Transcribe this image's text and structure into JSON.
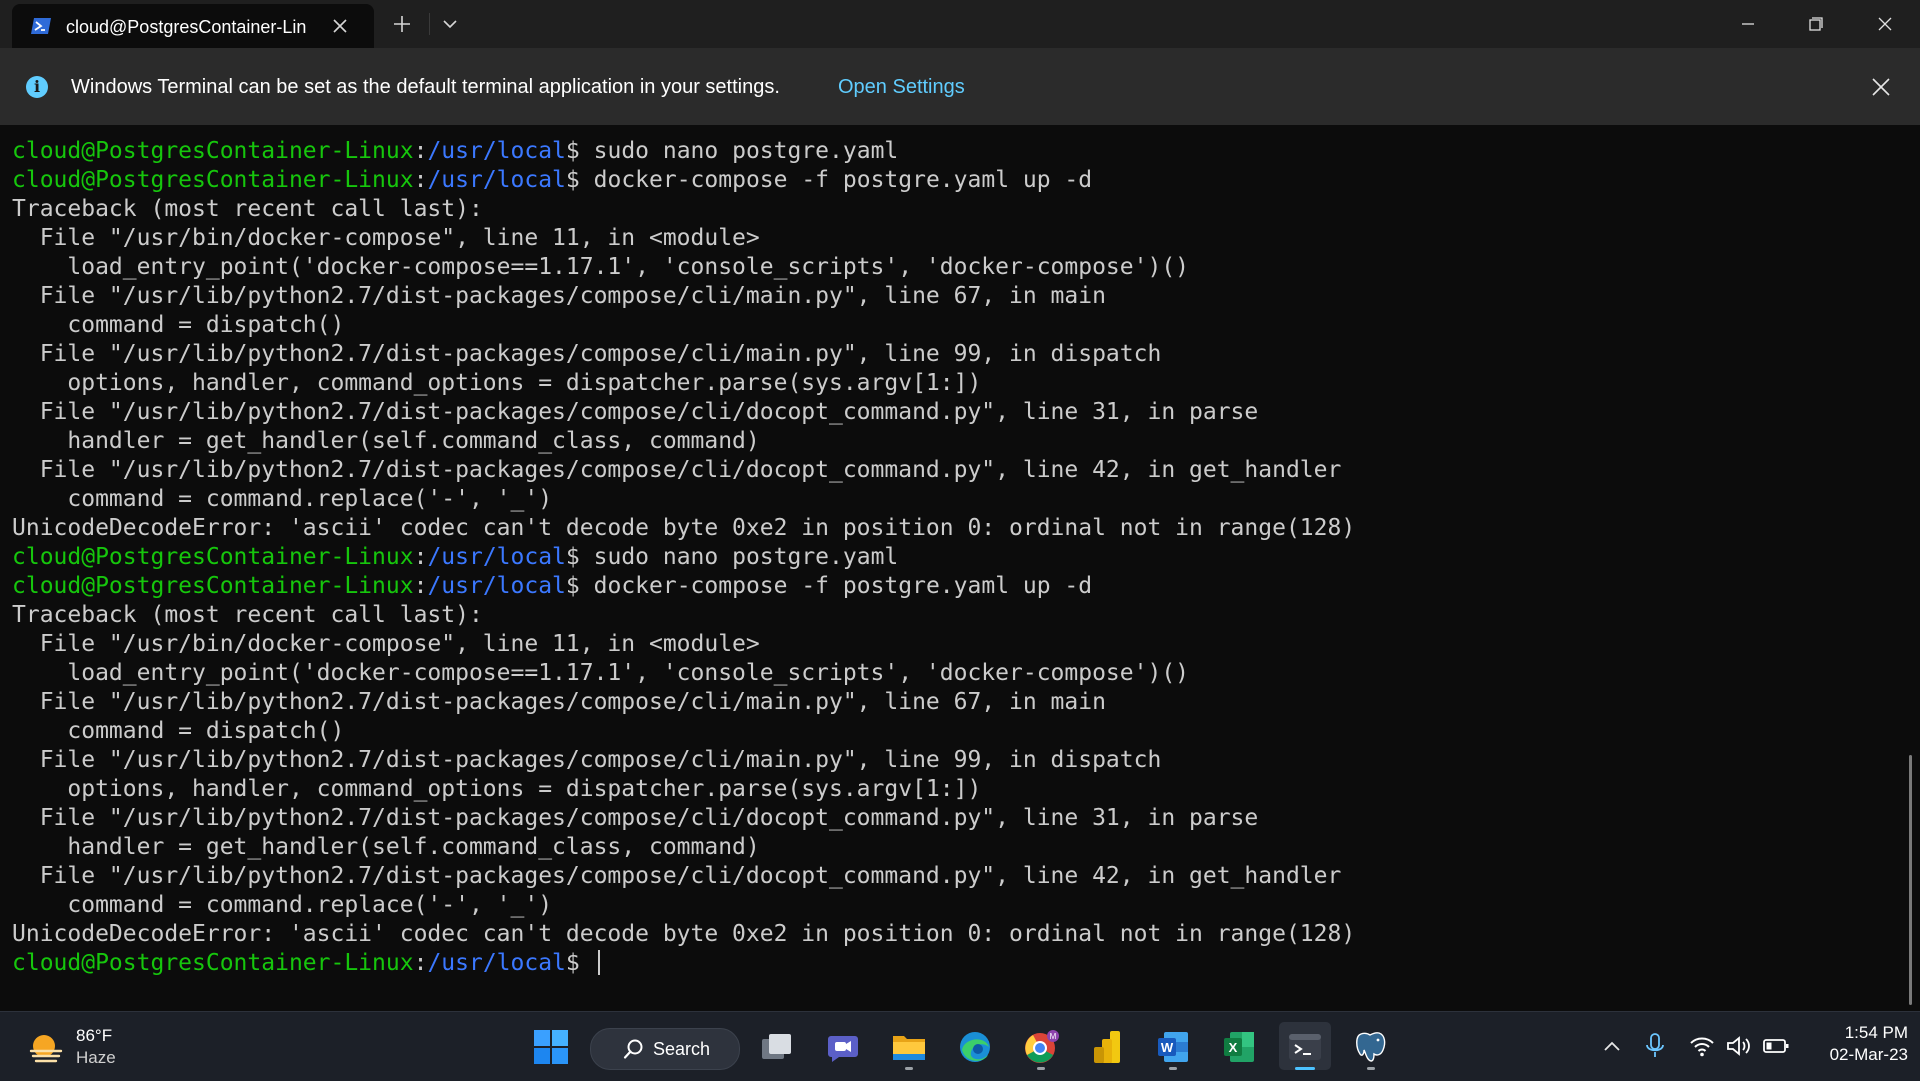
{
  "window": {
    "tab_title": "cloud@PostgresContainer-Lin",
    "accent_color": "#60cdff"
  },
  "infobar": {
    "message": "Windows Terminal can be set as the default terminal application in your settings.",
    "link": "Open Settings"
  },
  "terminal": {
    "colors": {
      "user_host": "#16c60c",
      "path": "#3b78ff",
      "text": "#cccccc",
      "background": "#0c0c0c"
    },
    "lines": [
      {
        "type": "prompt",
        "user": "cloud@PostgresContainer-Linux",
        "sep": ":",
        "path": "/usr/local",
        "sym": "$ ",
        "cmd": "sudo nano postgre.yaml"
      },
      {
        "type": "prompt",
        "user": "cloud@PostgresContainer-Linux",
        "sep": ":",
        "path": "/usr/local",
        "sym": "$ ",
        "cmd": "docker-compose -f postgre.yaml up -d"
      },
      {
        "type": "output",
        "text": "Traceback (most recent call last):"
      },
      {
        "type": "output",
        "text": "  File \"/usr/bin/docker-compose\", line 11, in <module>"
      },
      {
        "type": "output",
        "text": "    load_entry_point('docker-compose==1.17.1', 'console_scripts', 'docker-compose')()"
      },
      {
        "type": "output",
        "text": "  File \"/usr/lib/python2.7/dist-packages/compose/cli/main.py\", line 67, in main"
      },
      {
        "type": "output",
        "text": "    command = dispatch()"
      },
      {
        "type": "output",
        "text": "  File \"/usr/lib/python2.7/dist-packages/compose/cli/main.py\", line 99, in dispatch"
      },
      {
        "type": "output",
        "text": "    options, handler, command_options = dispatcher.parse(sys.argv[1:])"
      },
      {
        "type": "output",
        "text": "  File \"/usr/lib/python2.7/dist-packages/compose/cli/docopt_command.py\", line 31, in parse"
      },
      {
        "type": "output",
        "text": "    handler = get_handler(self.command_class, command)"
      },
      {
        "type": "output",
        "text": "  File \"/usr/lib/python2.7/dist-packages/compose/cli/docopt_command.py\", line 42, in get_handler"
      },
      {
        "type": "output",
        "text": "    command = command.replace('-', '_')"
      },
      {
        "type": "output",
        "text": "UnicodeDecodeError: 'ascii' codec can't decode byte 0xe2 in position 0: ordinal not in range(128)"
      },
      {
        "type": "prompt",
        "user": "cloud@PostgresContainer-Linux",
        "sep": ":",
        "path": "/usr/local",
        "sym": "$ ",
        "cmd": "sudo nano postgre.yaml"
      },
      {
        "type": "prompt",
        "user": "cloud@PostgresContainer-Linux",
        "sep": ":",
        "path": "/usr/local",
        "sym": "$ ",
        "cmd": "docker-compose -f postgre.yaml up -d"
      },
      {
        "type": "output",
        "text": "Traceback (most recent call last):"
      },
      {
        "type": "output",
        "text": "  File \"/usr/bin/docker-compose\", line 11, in <module>"
      },
      {
        "type": "output",
        "text": "    load_entry_point('docker-compose==1.17.1', 'console_scripts', 'docker-compose')()"
      },
      {
        "type": "output",
        "text": "  File \"/usr/lib/python2.7/dist-packages/compose/cli/main.py\", line 67, in main"
      },
      {
        "type": "output",
        "text": "    command = dispatch()"
      },
      {
        "type": "output",
        "text": "  File \"/usr/lib/python2.7/dist-packages/compose/cli/main.py\", line 99, in dispatch"
      },
      {
        "type": "output",
        "text": "    options, handler, command_options = dispatcher.parse(sys.argv[1:])"
      },
      {
        "type": "output",
        "text": "  File \"/usr/lib/python2.7/dist-packages/compose/cli/docopt_command.py\", line 31, in parse"
      },
      {
        "type": "output",
        "text": "    handler = get_handler(self.command_class, command)"
      },
      {
        "type": "output",
        "text": "  File \"/usr/lib/python2.7/dist-packages/compose/cli/docopt_command.py\", line 42, in get_handler"
      },
      {
        "type": "output",
        "text": "    command = command.replace('-', '_')"
      },
      {
        "type": "output",
        "text": "UnicodeDecodeError: 'ascii' codec can't decode byte 0xe2 in position 0: ordinal not in range(128)"
      },
      {
        "type": "prompt",
        "user": "cloud@PostgresContainer-Linux",
        "sep": ":",
        "path": "/usr/local",
        "sym": "$ ",
        "cmd": "",
        "cursor": true
      }
    ]
  },
  "taskbar": {
    "weather": {
      "temp": "86°F",
      "condition": "Haze",
      "icon": "sun-haze-icon"
    },
    "search_label": "Search",
    "apps": [
      {
        "name": "start-button",
        "icon": "windows-logo-icon"
      },
      {
        "name": "task-view-button",
        "icon": "task-view-icon"
      },
      {
        "name": "chat-button",
        "icon": "teams-chat-icon"
      },
      {
        "name": "file-explorer-button",
        "icon": "folder-icon",
        "running": true
      },
      {
        "name": "edge-button",
        "icon": "edge-icon"
      },
      {
        "name": "chrome-button",
        "icon": "chrome-icon",
        "running": true,
        "badge": "M"
      },
      {
        "name": "power-bi-button",
        "icon": "power-bi-icon"
      },
      {
        "name": "word-button",
        "icon": "word-icon",
        "running": true,
        "letter": "W"
      },
      {
        "name": "excel-button",
        "icon": "excel-icon",
        "letter": "X"
      },
      {
        "name": "terminal-button",
        "icon": "terminal-icon",
        "running": true,
        "active": true
      },
      {
        "name": "pgadmin-button",
        "icon": "postgres-elephant-icon",
        "running": true
      }
    ],
    "clock": {
      "time": "1:54 PM",
      "date": "02-Mar-23"
    }
  }
}
